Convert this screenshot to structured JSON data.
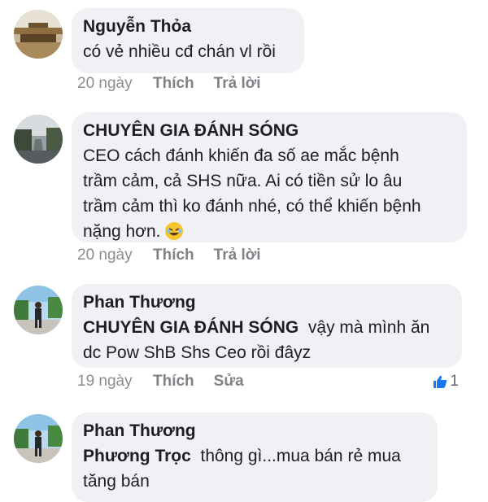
{
  "comments": [
    {
      "author": "Nguyễn Thỏa",
      "text": "có vẻ nhiều cđ chán vl rồi",
      "time": "20 ngày",
      "action1": "Thích",
      "action2": "Trả lời"
    },
    {
      "author": "CHUYÊN GIA ĐÁNH SÓNG",
      "line1": "CEO cách đánh khiến đa số ae mắc bệnh",
      "line2": "trầm cảm, cả SHS nữa. Ai có tiền sử lo âu",
      "line3": "trầm cảm thì ko đánh nhé, có thể khiến bệnh",
      "line4": "nặng hơn.",
      "emoji": "rolling-on-floor-laughing-emoji",
      "time": "20 ngày",
      "action1": "Thích",
      "action2": "Trả lời"
    },
    {
      "author": "Phan Thương",
      "mention": "CHUYÊN GIA ĐÁNH SÓNG",
      "text_after_mention": "vậy mà mình ăn",
      "line2": "dc Pow ShB Shs Ceo rồi đâyz",
      "time": "19 ngày",
      "action1": "Thích",
      "action2": "Sửa",
      "likes": "1"
    },
    {
      "author": "Phan Thương",
      "mention": "Phương Trọc",
      "text_after_mention": "thông gì...mua bán rẻ mua",
      "line2": "tăng bán"
    }
  ],
  "colors": {
    "bubble": "#eff1f4",
    "meta": "#8a8d91",
    "like_blue": "#1877f2"
  }
}
